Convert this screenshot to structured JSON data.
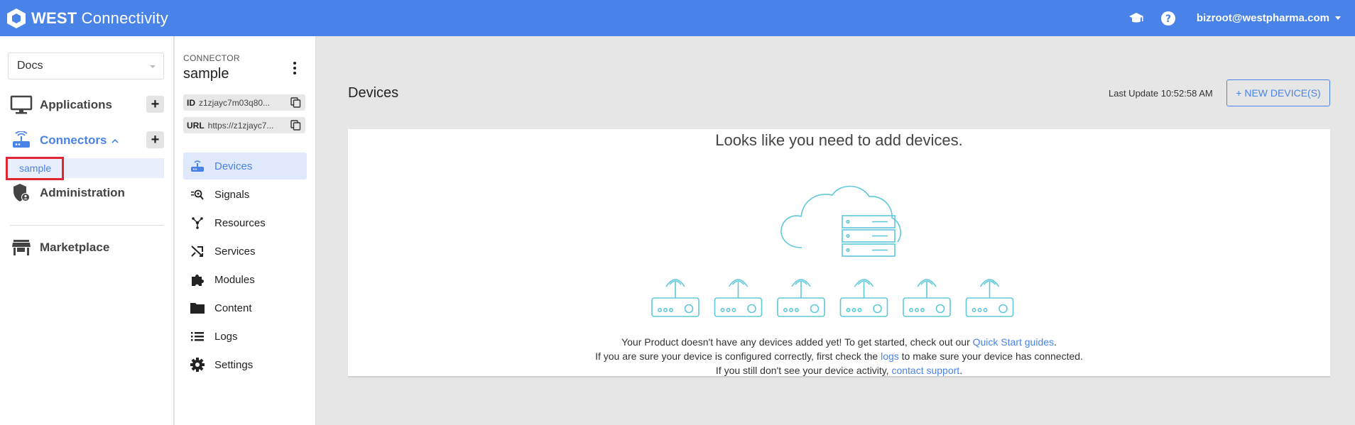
{
  "header": {
    "brand_bold": "WEST",
    "brand_rest": " Connectivity",
    "user_email": "bizroot@westpharma.com"
  },
  "sidebar": {
    "docs_select_value": "Docs",
    "items": {
      "applications": "Applications",
      "connectors": "Connectors",
      "connector_sub": "sample",
      "administration": "Administration",
      "marketplace": "Marketplace"
    },
    "add_symbol": "+"
  },
  "connector": {
    "type_label": "CONNECTOR",
    "name": "sample",
    "id_label": "ID",
    "id_value": "z1zjayc7m03q80...",
    "url_label": "URL",
    "url_value": "https://z1zjayc7..."
  },
  "menu": {
    "items": [
      "Devices",
      "Signals",
      "Resources",
      "Services",
      "Modules",
      "Content",
      "Logs",
      "Settings"
    ]
  },
  "main": {
    "title": "Devices",
    "last_update": "Last Update 10:52:58 AM",
    "new_device_label": "+ NEW DEVICE(S)",
    "card": {
      "heading": "Looks like you need to add devices.",
      "line1_text": "Your Product doesn't have any devices added yet!  To get started, check out our ",
      "line1_link": "Quick Start guides",
      "line1_end": ".",
      "line2_text": "If you are sure your device is configured correctly, first check the ",
      "line2_link": "logs",
      "line2_end": " to make sure your device has connected.",
      "line3_text": "If you still don't see your device activity, ",
      "line3_link": "contact support",
      "line3_end": "."
    }
  },
  "colors": {
    "brand": "#4a83e8",
    "illustration": "#5ec8da",
    "highlight": "#e22533"
  }
}
